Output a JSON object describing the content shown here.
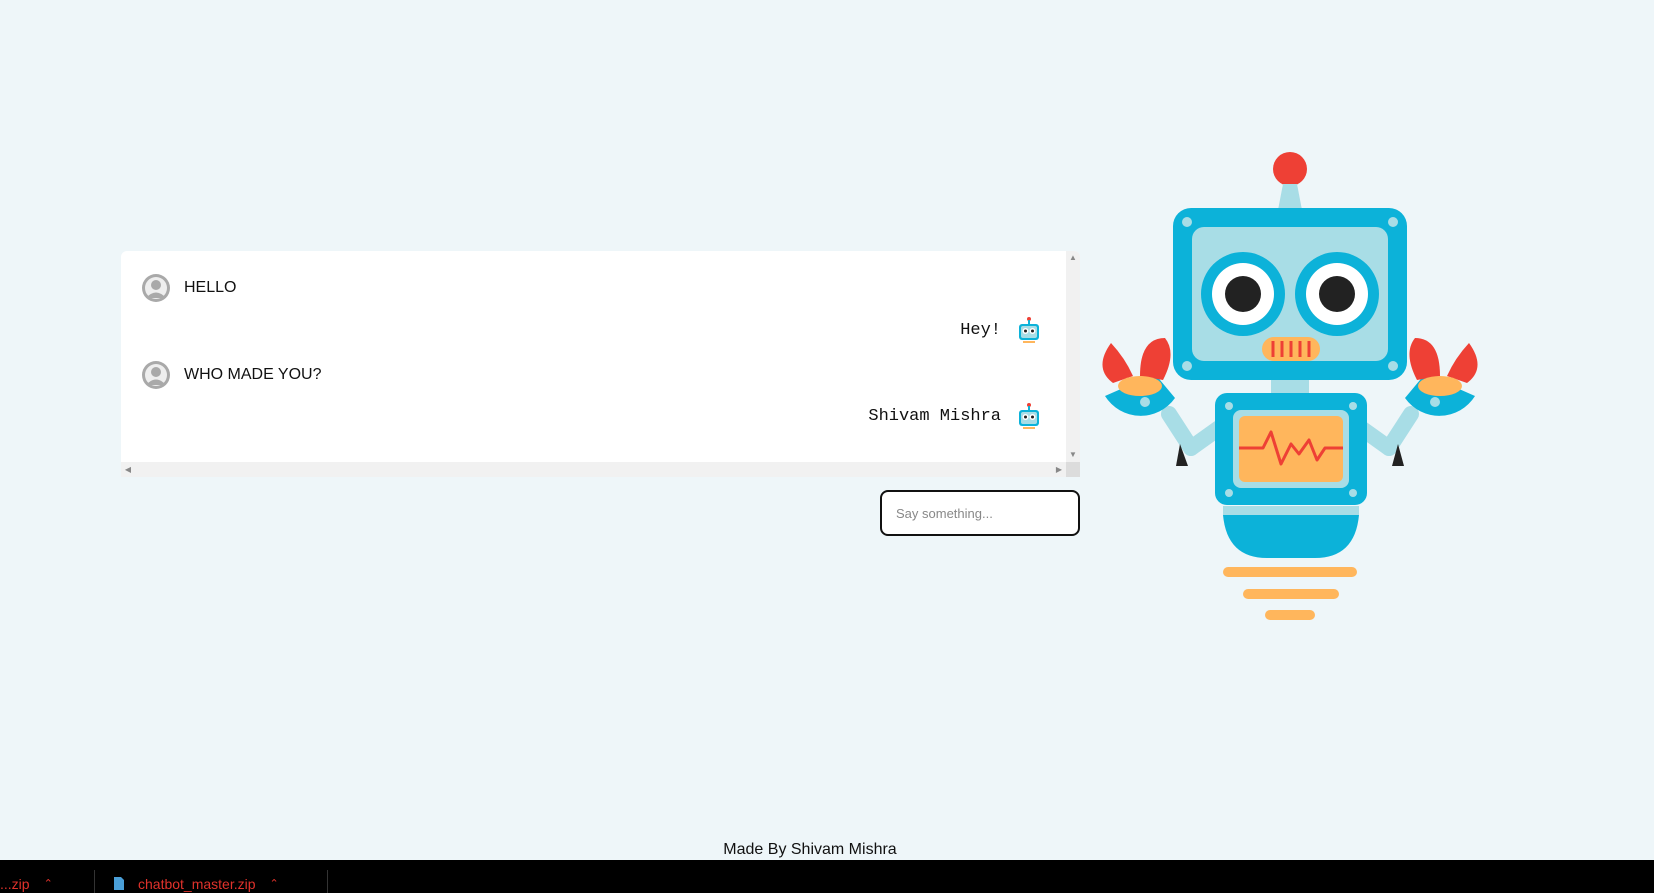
{
  "chat": {
    "messages": [
      {
        "sender": "user",
        "text": "HELLO"
      },
      {
        "sender": "bot",
        "text": "Hey!"
      },
      {
        "sender": "user",
        "text": "WHO MADE YOU?"
      },
      {
        "sender": "bot",
        "text": "Shivam Mishra"
      }
    ]
  },
  "input": {
    "placeholder": "Say something...",
    "value": ""
  },
  "footer": {
    "credit": "Made By Shivam Mishra"
  },
  "downloads": {
    "items": [
      {
        "name": "...zip"
      },
      {
        "name": "chatbot_master.zip"
      }
    ]
  },
  "colors": {
    "background": "#eef6f9",
    "robot_primary": "#0cb2d9",
    "robot_light": "#a8dde6",
    "robot_accent_red": "#ee4035",
    "robot_accent_orange": "#ffb65c"
  },
  "icons": [
    "user-avatar-icon",
    "bot-avatar-icon",
    "file-icon",
    "chevron-up-icon"
  ]
}
